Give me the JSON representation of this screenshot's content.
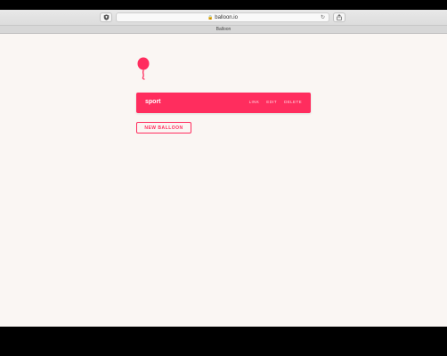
{
  "browser": {
    "url": "balloon.io",
    "tab_title": "Balloon",
    "icons": {
      "privacy": "shield-icon",
      "secure": "lock-icon",
      "reload": "reload-icon",
      "share": "share-icon"
    }
  },
  "app": {
    "logo_icon": "balloon-icon",
    "accent_color": "#ff2d5e",
    "background_color": "#faf6f3",
    "balloons": [
      {
        "title": "sport",
        "actions": {
          "link": "LINK",
          "edit": "EDIT",
          "delete": "DELETE"
        }
      }
    ],
    "new_button_label": "NEW BALLOON"
  }
}
